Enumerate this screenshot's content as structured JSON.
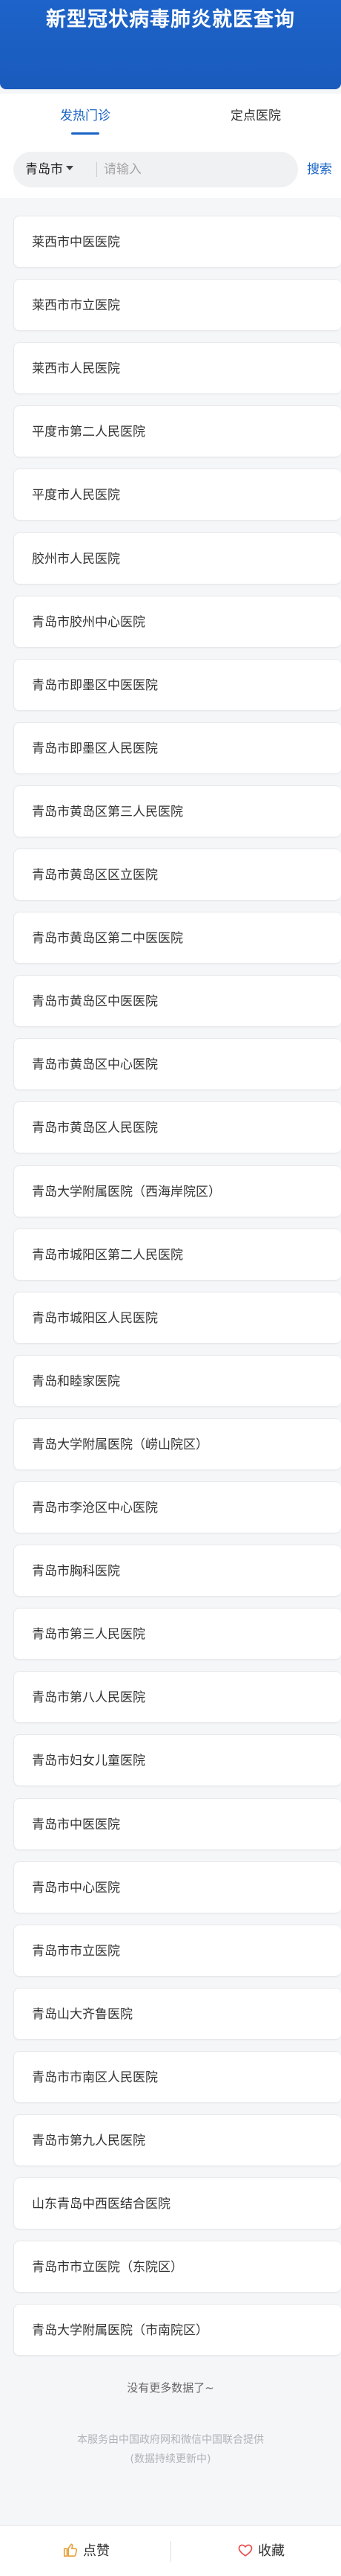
{
  "header": {
    "title": "新型冠状病毒肺炎就医查询"
  },
  "tabs": [
    {
      "label": "发热门诊"
    },
    {
      "label": "定点医院"
    }
  ],
  "search": {
    "city": "青岛市",
    "placeholder": "请输入",
    "button": "搜索"
  },
  "hospitals": [
    "莱西市中医医院",
    "莱西市市立医院",
    "莱西市人民医院",
    "平度市第二人民医院",
    "平度市人民医院",
    "胶州市人民医院",
    "青岛市胶州中心医院",
    "青岛市即墨区中医医院",
    "青岛市即墨区人民医院",
    "青岛市黄岛区第三人民医院",
    "青岛市黄岛区区立医院",
    "青岛市黄岛区第二中医医院",
    "青岛市黄岛区中医医院",
    "青岛市黄岛区中心医院",
    "青岛市黄岛区人民医院",
    "青岛大学附属医院（西海岸院区）",
    "青岛市城阳区第二人民医院",
    "青岛市城阳区人民医院",
    "青岛和睦家医院",
    "青岛大学附属医院（崂山院区）",
    "青岛市李沧区中心医院",
    "青岛市胸科医院",
    "青岛市第三人民医院",
    "青岛市第八人民医院",
    "青岛市妇女儿童医院",
    "青岛市中医医院",
    "青岛市中心医院",
    "青岛市市立医院",
    "青岛山大齐鲁医院",
    "青岛市市南区人民医院",
    "青岛市第九人民医院",
    "山东青岛中西医结合医院",
    "青岛市市立医院（东院区）",
    "青岛大学附属医院（市南院区）"
  ],
  "footer": {
    "no_more": "没有更多数据了~",
    "source_line1": "本服务由中国政府网和微信中国联合提供",
    "source_line2": "(数据持续更新中)"
  },
  "bottom_bar": {
    "like_label": "点赞",
    "favorite_label": "收藏"
  },
  "colors": {
    "brand_blue": "#1a63c6",
    "like_icon": "#e6a23c",
    "favorite_icon": "#e64a4a"
  },
  "icons": {
    "like": "thumbs-up-icon",
    "favorite": "heart-icon",
    "city_caret": "caret-down-icon"
  }
}
